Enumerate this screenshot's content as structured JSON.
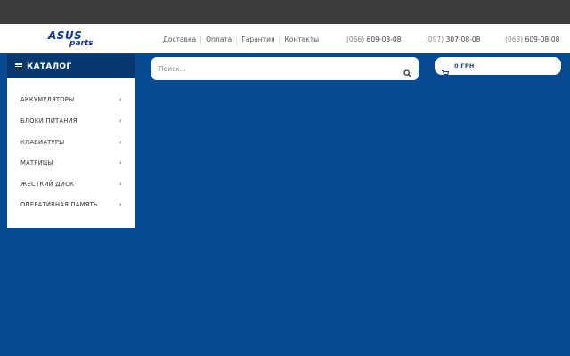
{
  "logo": {
    "line1": "ASUS",
    "line2": "parts"
  },
  "nav": {
    "items": [
      {
        "label": "Доставка"
      },
      {
        "label": "Оплата"
      },
      {
        "label": "Гарантия"
      },
      {
        "label": "Контакты"
      }
    ]
  },
  "phones": [
    {
      "code": "(066)",
      "number": "609-08-08"
    },
    {
      "code": "(097)",
      "number": "307-08-08"
    },
    {
      "code": "(063)",
      "number": "609-08-08"
    }
  ],
  "catalog": {
    "title": "КАТАЛОГ",
    "items": [
      {
        "label": "АККУМУЛЯТОРЫ"
      },
      {
        "label": "БЛОКИ ПИТАНИЯ"
      },
      {
        "label": "КЛАВИАТУРЫ"
      },
      {
        "label": "МАТРИЦЫ"
      },
      {
        "label": "ЖЕСТКИЙ ДИСК"
      },
      {
        "label": "ОПЕРАТИВНАЯ ПАМЯТЬ"
      }
    ],
    "chevron": "›"
  },
  "search": {
    "placeholder": "Поиск...",
    "value": "",
    "icon": "search-icon"
  },
  "cart": {
    "amount": "0 ГРН",
    "icon": "cart-icon"
  },
  "colors": {
    "page_background": "#064a93",
    "top_bar": "#3b3b3b",
    "catalog_header": "#07396f",
    "logo": "#13379a"
  }
}
